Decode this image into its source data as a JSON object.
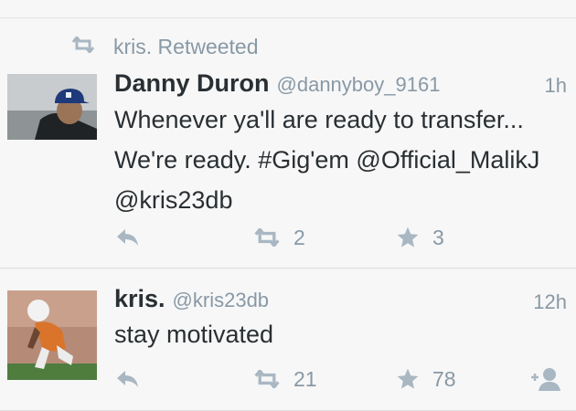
{
  "tweets": [
    {
      "retweeted_by": "kris. Retweeted",
      "name": "Danny Duron",
      "handle": "@dannyboy_9161",
      "time": "1h",
      "text_lines": [
        "Whenever ya'll are ready to transfer...",
        "We're ready.  #Gig'em @Official_MalikJ",
        "@kris23db"
      ],
      "retweets": "2",
      "favorites": "3",
      "icons": {
        "retweeted": "retweet-icon",
        "reply": "reply-icon",
        "retweet": "retweet-icon",
        "favorite": "star-icon"
      }
    },
    {
      "name": "kris.",
      "handle": "@kris23db",
      "time": "12h",
      "text_lines": [
        "stay motivated"
      ],
      "retweets": "21",
      "favorites": "78",
      "icons": {
        "reply": "reply-icon",
        "retweet": "retweet-icon",
        "favorite": "star-icon",
        "follow": "add-user-icon"
      }
    }
  ],
  "colors": {
    "text": "#292f33",
    "muted": "#8899a6",
    "icon": "#a9b7c3",
    "background": "#f7f7f7",
    "divider": "#dedede"
  }
}
